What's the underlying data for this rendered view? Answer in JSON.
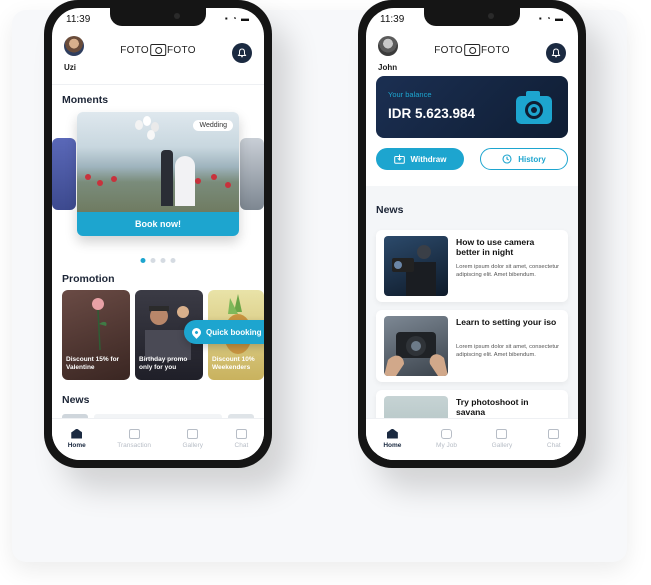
{
  "colors": {
    "accent": "#1da5cf",
    "navy": "#1b2a41",
    "card_dark": "#12223c"
  },
  "left_phone": {
    "status_time": "11:39",
    "status_indicators": "..ـ ≡ ▬",
    "user_name": "Uzi",
    "logo_left": "FOTO",
    "logo_right": "FOTO",
    "moments_title": "Moments",
    "moment_tag": "Wedding",
    "book_now_label": "Book now!",
    "promotion_title": "Promotion",
    "promos": [
      {
        "label": "Discount 15% for Valentine"
      },
      {
        "label": "Birthday promo only for you"
      },
      {
        "label": "Discount 10% Weekenders"
      }
    ],
    "quick_booking_label": "Quick booking",
    "news_title": "News",
    "nav": [
      {
        "label": "Home",
        "icon": "home-icon"
      },
      {
        "label": "Transaction",
        "icon": "transaction-icon"
      },
      {
        "label": "Gallery",
        "icon": "gallery-icon"
      },
      {
        "label": "Chat",
        "icon": "chat-icon"
      }
    ]
  },
  "right_phone": {
    "status_time": "11:39",
    "user_name": "John",
    "logo_left": "FOTO",
    "logo_right": "FOTO",
    "balance_label": "Your balance",
    "balance_value": "IDR 5.623.984",
    "withdraw_label": "Withdraw",
    "history_label": "History",
    "news_title": "News",
    "news": [
      {
        "title": "How to use camera better in night",
        "body": "Lorem ipsum dolor sit amet, consectetur adipiscing elit. Amet bibendum."
      },
      {
        "title": "Learn to setting your iso",
        "body": "Lorem ipsum dolor sit amet, consectetur adipiscing elit. Amet bibendum."
      },
      {
        "title": "Try photoshoot in savana",
        "body": ""
      }
    ],
    "nav": [
      {
        "label": "Home",
        "icon": "home-icon"
      },
      {
        "label": "My Job",
        "icon": "camera-icon"
      },
      {
        "label": "Gallery",
        "icon": "gallery-icon"
      },
      {
        "label": "Chat",
        "icon": "chat-icon"
      }
    ]
  }
}
